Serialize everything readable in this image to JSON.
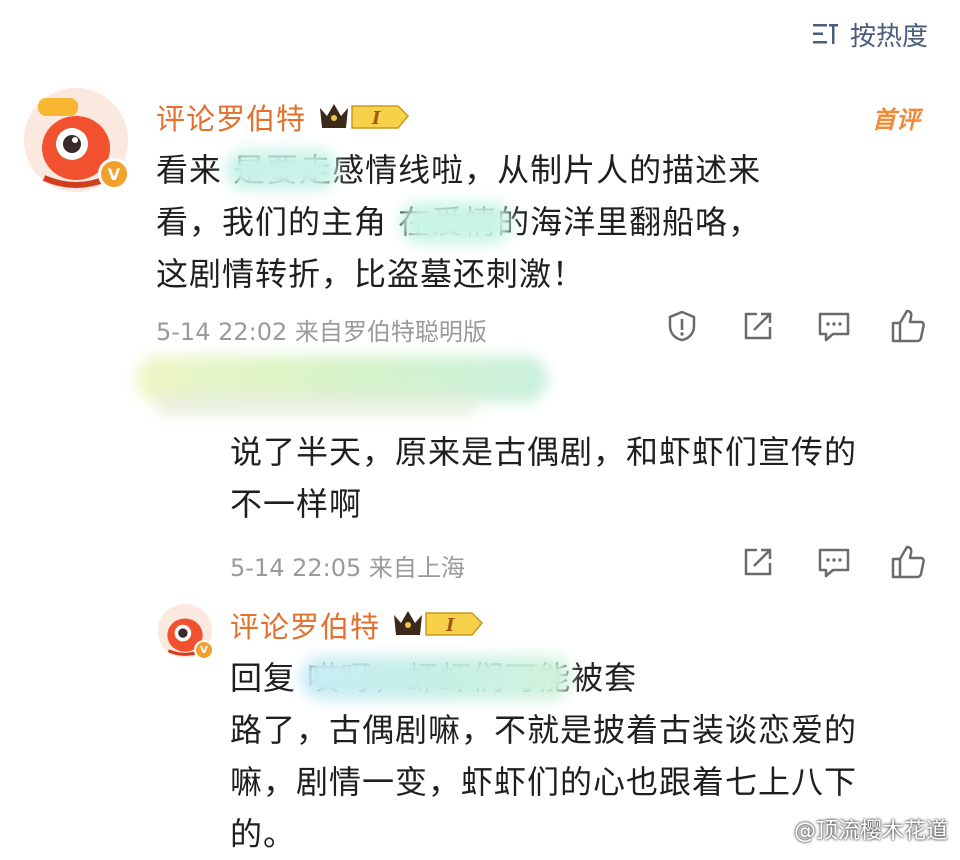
{
  "sort": {
    "label": "按热度"
  },
  "comment1": {
    "username": "评论罗伯特",
    "level": "I",
    "badge": "首评",
    "lines": [
      "看来              是要走感情线啦，从制片人的描述来",
      "看，我们的主角            在爱情的海洋里翻船咯，",
      "这剧情转折，比盗墓还刺激！"
    ],
    "meta": "5-14 22:02 来自罗伯特聪明版"
  },
  "reply1": {
    "lines": [
      "说了半天，原来是古偶剧，和虾虾们宣传的",
      "不一样啊"
    ],
    "meta": "5-14 22:05 来自上海"
  },
  "reply2": {
    "username": "评论罗伯特",
    "level": "I",
    "lines": [
      "回复                                        哎呀，虾虾们可能被套",
      "路了，古偶剧嘛，不就是披着古装谈恋爱的",
      "嘛，剧情一变，虾虾们的心也跟着七上八下",
      "的。"
    ]
  },
  "watermark": "@顶流樱木花道",
  "colors": {
    "username": "#e3702d",
    "sort": "#4a5d7a",
    "meta": "#9a9a9a",
    "icon": "#6b6b6b"
  },
  "icons": [
    "sort-icon",
    "report-icon",
    "share-icon",
    "comment-icon",
    "like-icon"
  ]
}
